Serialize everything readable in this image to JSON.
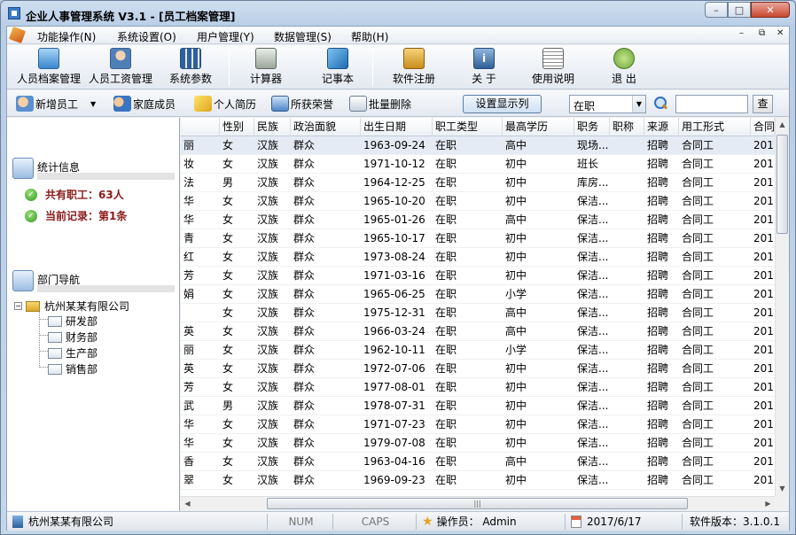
{
  "window": {
    "title": "企业人事管理系统 V3.1  - [员工档案管理]",
    "buttons": [
      "–",
      "□",
      "✕"
    ]
  },
  "menubar": {
    "items": [
      "功能操作(N)",
      "系统设置(O)",
      "用户管理(Y)",
      "数据管理(S)",
      "帮助(H)"
    ],
    "mdi_buttons": [
      "–",
      "⧉",
      "✕"
    ]
  },
  "toolbar": {
    "items": [
      "人员档案管理",
      "人员工资管理",
      "系统参数",
      "计算器",
      "记事本",
      "软件注册",
      "关 于",
      "使用说明",
      "退 出"
    ]
  },
  "actionbar": {
    "new_employee": "新增员工",
    "family": "家庭成员",
    "resume": "个人简历",
    "honors": "所获荣誉",
    "batch_delete": "批量删除",
    "display_settings": "设置显示列",
    "status_filter": "在职",
    "search_placeholder": "",
    "query": "查"
  },
  "left": {
    "stats_title": "统计信息",
    "total": "共有职工：63人",
    "current": "当前记录：第1条",
    "dept_title": "部门导航",
    "root": "杭州某某有限公司",
    "departments": [
      "研发部",
      "财务部",
      "生产部",
      "销售部"
    ]
  },
  "grid": {
    "columns": [
      "",
      "性别",
      "民族",
      "政治面貌",
      "出生日期",
      "职工类型",
      "最高学历",
      "职务",
      "职称",
      "来源",
      "用工形式",
      "合同"
    ],
    "rows": [
      [
        "丽",
        "女",
        "汉族",
        "群众",
        "1963-09-24",
        "在职",
        "高中",
        "现场...",
        "",
        "招聘",
        "合同工",
        "201"
      ],
      [
        "妆",
        "女",
        "汉族",
        "群众",
        "1971-10-12",
        "在职",
        "初中",
        "班长",
        "",
        "招聘",
        "合同工",
        "201"
      ],
      [
        "法",
        "男",
        "汉族",
        "群众",
        "1964-12-25",
        "在职",
        "初中",
        "库房...",
        "",
        "招聘",
        "合同工",
        "201"
      ],
      [
        "华",
        "女",
        "汉族",
        "群众",
        "1965-10-20",
        "在职",
        "初中",
        "保洁...",
        "",
        "招聘",
        "合同工",
        "201"
      ],
      [
        "华",
        "女",
        "汉族",
        "群众",
        "1965-01-26",
        "在职",
        "高中",
        "保洁...",
        "",
        "招聘",
        "合同工",
        "201"
      ],
      [
        "青",
        "女",
        "汉族",
        "群众",
        "1965-10-17",
        "在职",
        "初中",
        "保洁...",
        "",
        "招聘",
        "合同工",
        "201"
      ],
      [
        "红",
        "女",
        "汉族",
        "群众",
        "1973-08-24",
        "在职",
        "初中",
        "保洁...",
        "",
        "招聘",
        "合同工",
        "201"
      ],
      [
        "芳",
        "女",
        "汉族",
        "群众",
        "1971-03-16",
        "在职",
        "初中",
        "保洁...",
        "",
        "招聘",
        "合同工",
        "201"
      ],
      [
        "娟",
        "女",
        "汉族",
        "群众",
        "1965-06-25",
        "在职",
        "小学",
        "保洁...",
        "",
        "招聘",
        "合同工",
        "201"
      ],
      [
        "",
        "女",
        "汉族",
        "群众",
        "1975-12-31",
        "在职",
        "高中",
        "保洁...",
        "",
        "招聘",
        "合同工",
        "201"
      ],
      [
        "英",
        "女",
        "汉族",
        "群众",
        "1966-03-24",
        "在职",
        "高中",
        "保洁...",
        "",
        "招聘",
        "合同工",
        "201"
      ],
      [
        "丽",
        "女",
        "汉族",
        "群众",
        "1962-10-11",
        "在职",
        "小学",
        "保洁...",
        "",
        "招聘",
        "合同工",
        "201"
      ],
      [
        "英",
        "女",
        "汉族",
        "群众",
        "1972-07-06",
        "在职",
        "初中",
        "保洁...",
        "",
        "招聘",
        "合同工",
        "201"
      ],
      [
        "芳",
        "女",
        "汉族",
        "群众",
        "1977-08-01",
        "在职",
        "初中",
        "保洁...",
        "",
        "招聘",
        "合同工",
        "201"
      ],
      [
        "武",
        "男",
        "汉族",
        "群众",
        "1978-07-31",
        "在职",
        "初中",
        "保洁...",
        "",
        "招聘",
        "合同工",
        "201"
      ],
      [
        "华",
        "女",
        "汉族",
        "群众",
        "1971-07-23",
        "在职",
        "初中",
        "保洁...",
        "",
        "招聘",
        "合同工",
        "201"
      ],
      [
        "华",
        "女",
        "汉族",
        "群众",
        "1979-07-08",
        "在职",
        "初中",
        "保洁...",
        "",
        "招聘",
        "合同工",
        "201"
      ],
      [
        "香",
        "女",
        "汉族",
        "群众",
        "1963-04-16",
        "在职",
        "高中",
        "保洁...",
        "",
        "招聘",
        "合同工",
        "201"
      ],
      [
        "翠",
        "女",
        "汉族",
        "群众",
        "1969-09-23",
        "在职",
        "初中",
        "保洁...",
        "",
        "招聘",
        "合同工",
        "201"
      ]
    ]
  },
  "statusbar": {
    "company": "杭州某某有限公司",
    "num": "NUM",
    "caps": "CAPS",
    "operator": "操作员： Admin",
    "date": "2017/6/17",
    "version": "软件版本：3.1.0.1"
  },
  "colors": {
    "accent": "#3b7bc8",
    "stat_text": "#8b1a1a",
    "selected_row": "#e4ebf5"
  }
}
